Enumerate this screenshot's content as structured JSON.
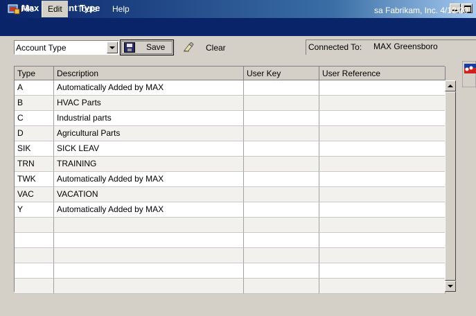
{
  "window": {
    "title": "Max Account Type"
  },
  "menu": {
    "items": [
      "File",
      "Edit",
      "Tools",
      "Help"
    ],
    "status": "sa  Fabrikam, Inc.  4/12/20"
  },
  "toolbar": {
    "account_select_value": "Account Type",
    "save_label": "Save",
    "clear_label": "Clear",
    "connected_label": "Connected To:",
    "connected_value": "MAX Greensboro"
  },
  "grid": {
    "columns": [
      "Type",
      "Description",
      "User Key",
      "User Reference"
    ],
    "rows": [
      {
        "type": "A",
        "description": "Automatically Added by MAX",
        "user_key": "",
        "user_reference": ""
      },
      {
        "type": "B",
        "description": "HVAC Parts",
        "user_key": "",
        "user_reference": ""
      },
      {
        "type": "C",
        "description": "Industrial parts",
        "user_key": "",
        "user_reference": ""
      },
      {
        "type": "D",
        "description": "Agricultural Parts",
        "user_key": "",
        "user_reference": ""
      },
      {
        "type": "SIK",
        "description": "SICK LEAV",
        "user_key": "",
        "user_reference": ""
      },
      {
        "type": "TRN",
        "description": "TRAINING",
        "user_key": "",
        "user_reference": ""
      },
      {
        "type": "TWK",
        "description": "Automatically Added by MAX",
        "user_key": "",
        "user_reference": ""
      },
      {
        "type": "VAC",
        "description": "VACATION",
        "user_key": "",
        "user_reference": ""
      },
      {
        "type": "Y",
        "description": "Automatically Added by MAX",
        "user_key": "",
        "user_reference": ""
      },
      {
        "type": "",
        "description": "",
        "user_key": "",
        "user_reference": ""
      },
      {
        "type": "",
        "description": "",
        "user_key": "",
        "user_reference": ""
      },
      {
        "type": "",
        "description": "",
        "user_key": "",
        "user_reference": ""
      },
      {
        "type": "",
        "description": "",
        "user_key": "",
        "user_reference": ""
      },
      {
        "type": "",
        "description": "",
        "user_key": "",
        "user_reference": ""
      }
    ]
  },
  "colors": {
    "titlebar": "#0a246a",
    "menubar": "#0a246a",
    "window_bg": "#d4d0c8",
    "alt_row": "#f2f1ed"
  },
  "icons": [
    "app-icon",
    "save-icon",
    "clear-icon",
    "navigation-icon"
  ]
}
